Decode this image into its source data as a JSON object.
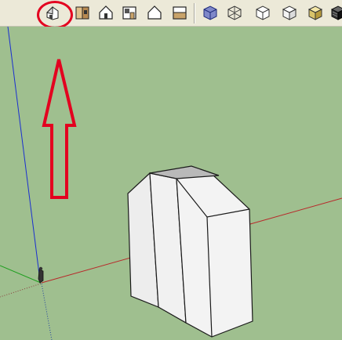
{
  "toolbar": {
    "groups": [
      {
        "name": "views",
        "buttons": [
          {
            "name": "iso-view",
            "icon": "house-iso-icon"
          },
          {
            "name": "top-view",
            "icon": "house-top-icon"
          },
          {
            "name": "front-view",
            "icon": "house-front-icon"
          },
          {
            "name": "right-view",
            "icon": "house-right-icon"
          },
          {
            "name": "back-view",
            "icon": "house-back-icon"
          },
          {
            "name": "left-view",
            "icon": "house-left-icon"
          }
        ]
      },
      {
        "name": "face-styles",
        "buttons": [
          {
            "name": "xray",
            "icon": "cube-xray-icon"
          },
          {
            "name": "wireframe",
            "icon": "cube-wireframe-icon"
          },
          {
            "name": "hidden-line",
            "icon": "cube-hidden-line-icon"
          },
          {
            "name": "shaded",
            "icon": "cube-shaded-icon"
          },
          {
            "name": "shaded-textures",
            "icon": "cube-textured-icon"
          },
          {
            "name": "monochrome",
            "icon": "cube-monochrome-icon"
          }
        ]
      }
    ]
  },
  "annotation": {
    "color": "#e3001f",
    "target": "iso-view"
  },
  "viewport": {
    "background": "#9fbf8f",
    "axis_colors": {
      "blue": "#1a2fd0",
      "red": "#b8282a",
      "green": "#1f9f1f"
    },
    "model": {
      "face_color": "#f2f2f2",
      "top_face_color": "#b9b9b9",
      "edge_color": "#1a1a1a"
    }
  }
}
